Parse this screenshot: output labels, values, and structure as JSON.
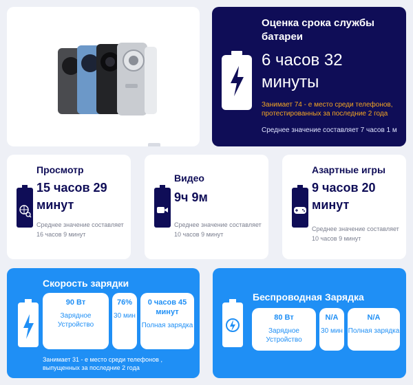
{
  "hero": {
    "title": "Оценка срока службы батареи",
    "value": "6 часов 32 минуты",
    "rank": "Занимает 74 - е место среди телефонов, протестированных за последние 2 года",
    "average": "Среднее значение составляет 7 часов 1 м"
  },
  "usage": [
    {
      "title": "Просмотр",
      "value": "15 часов 29 минут",
      "average": "Среднее значение составляет 16 часов 9 минут",
      "icon": "globe-search-icon"
    },
    {
      "title": "Видео",
      "value": "9ч 9м",
      "average": "Среднее значение составляет 10 часов 9 минут",
      "icon": "video-camera-icon"
    },
    {
      "title": "Азартные игры",
      "value": "9 часов 20 минут",
      "average": "Среднее значение составляет 10 часов 9 минут",
      "icon": "gamepad-icon"
    }
  ],
  "charging": {
    "title": "Скорость зарядки",
    "pills": [
      {
        "value": "90 Вт",
        "label": "Зарядное Устройство"
      },
      {
        "value": "76%",
        "label": "30 мин"
      },
      {
        "value": "0 часов 45 минут",
        "label": "Полная зарядка"
      }
    ],
    "rank": "Занимает 31 - е место среди телефонов , выпущенных за последние 2 года"
  },
  "wireless": {
    "title": "Беспроводная Зарядка",
    "pills": [
      {
        "value": "80 Вт",
        "label": "Зарядное Устройство"
      },
      {
        "value": "N/A",
        "label": "30 мин"
      },
      {
        "value": "N/A",
        "label": "Полная зарядка"
      }
    ]
  },
  "colors": {
    "navy": "#0f0d57",
    "blue": "#1f8ff5",
    "orange": "#f4a623"
  }
}
